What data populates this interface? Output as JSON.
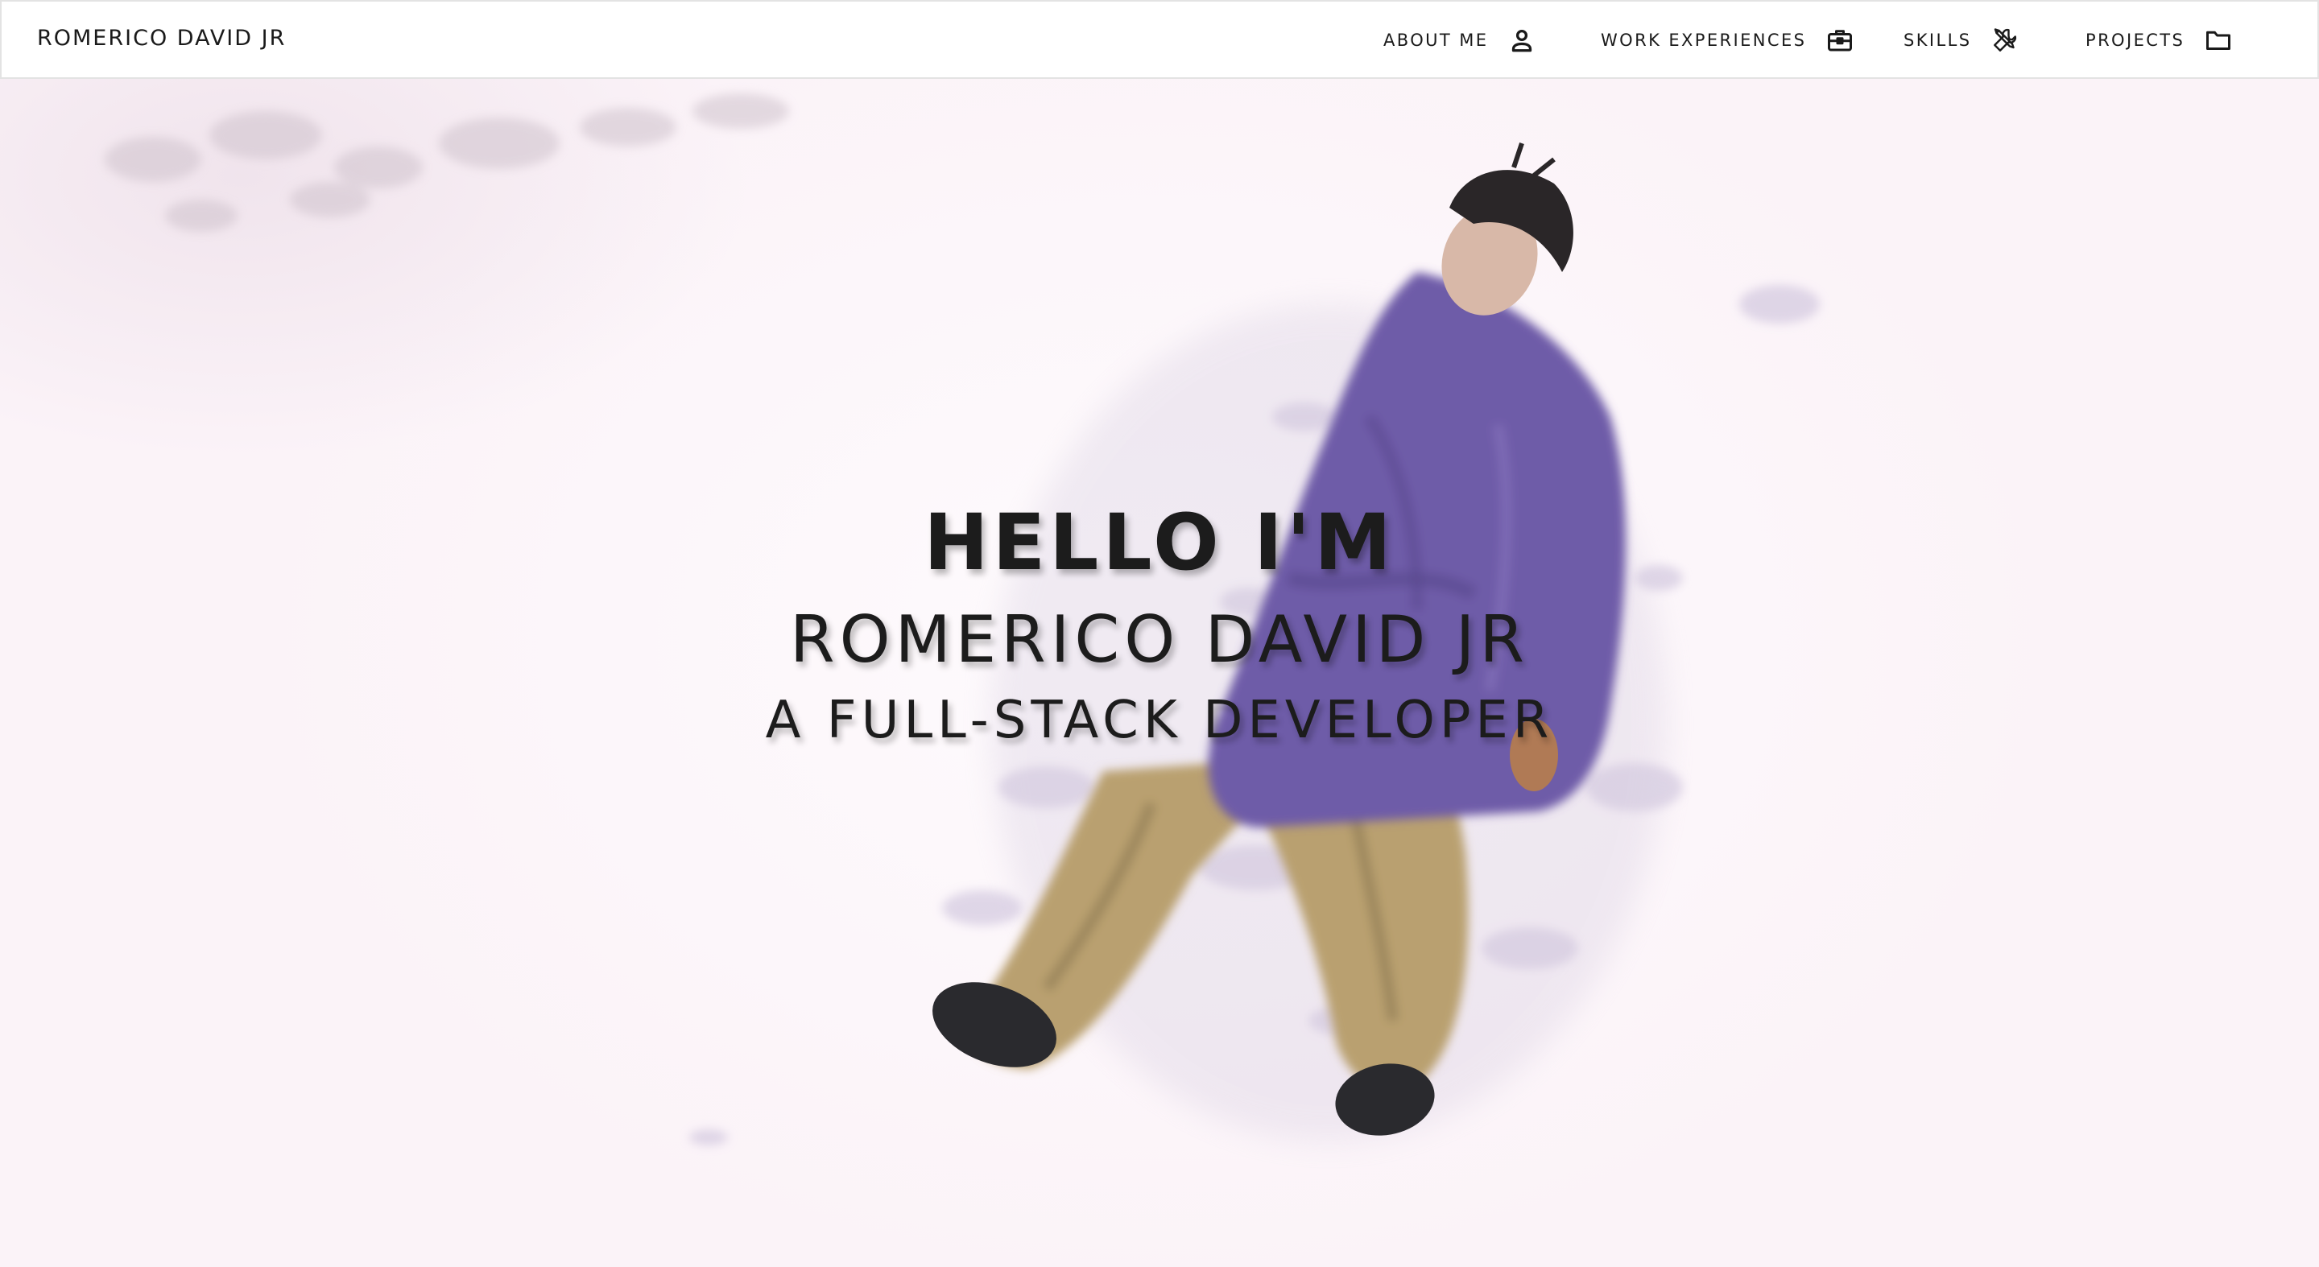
{
  "navbar": {
    "brand": "ROMERICO DAVID JR",
    "items": [
      {
        "label": "ABOUT ME",
        "icon": "person-icon"
      },
      {
        "label": "WORK EXPERIENCES",
        "icon": "briefcase-icon"
      },
      {
        "label": "SKILLS",
        "icon": "tools-icon"
      },
      {
        "label": "PROJECTS",
        "icon": "folder-icon"
      }
    ]
  },
  "hero": {
    "greeting": "HELLO I'M",
    "name": "ROMERICO DAVID JR",
    "role": "A FULL-STACK DEVELOPER",
    "background_art": "illustrated-man-lying-in-snow"
  },
  "colors": {
    "text": "#1c1c1c",
    "navbar_bg": "#ffffff",
    "hero_bg": "#fbf3f8",
    "jacket": "#6e5ba8",
    "pants": "#b9a070"
  }
}
